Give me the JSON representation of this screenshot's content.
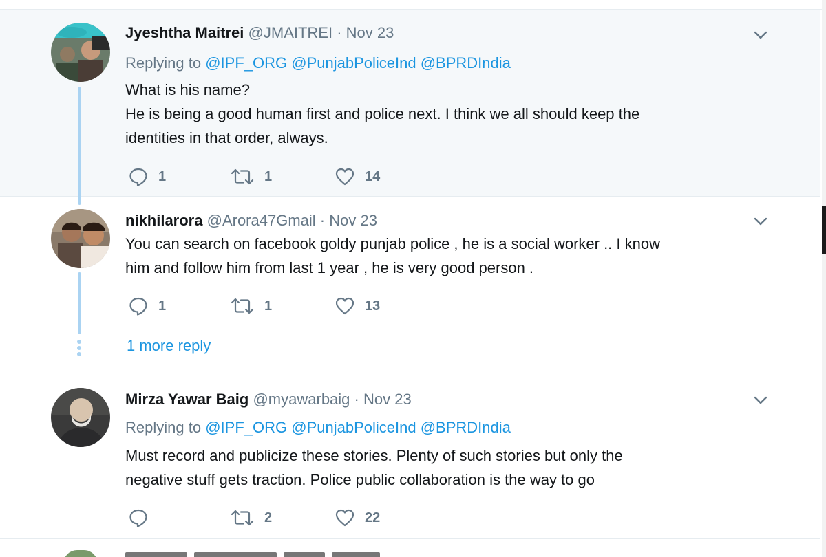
{
  "tweets": [
    {
      "name": "Jyeshtha Maitrei",
      "handle": "@JMAITREI",
      "dot": "·",
      "date": "Nov 23",
      "replying_label": "Replying to",
      "mentions": [
        "@IPF_ORG",
        "@PunjabPoliceInd",
        "@BPRDIndia"
      ],
      "lines": [
        "What is his name?",
        "He is being a good human first and police next. I think we all should keep the",
        "identities in that order, always."
      ],
      "replies": "1",
      "retweets": "1",
      "likes": "14"
    },
    {
      "name": "nikhilarora",
      "handle": "@Arora47Gmail",
      "dot": "·",
      "date": "Nov 23",
      "lines": [
        "You can search on facebook goldy punjab police , he is a social worker .. I know",
        "him and follow him from last 1 year , he is very good person ."
      ],
      "replies": "1",
      "retweets": "1",
      "likes": "13",
      "more_reply": "1 more reply"
    },
    {
      "name": "Mirza Yawar Baig",
      "handle": "@myawarbaig",
      "dot": "·",
      "date": "Nov 23",
      "replying_label": "Replying to",
      "mentions": [
        "@IPF_ORG",
        "@PunjabPoliceInd",
        "@BPRDIndia"
      ],
      "lines": [
        "Must record and publicize these stories. Plenty of such stories but only the",
        "negative stuff gets traction. Police public collaboration is the way to go"
      ],
      "replies": "",
      "retweets": "2",
      "likes": "22"
    }
  ],
  "icons": {
    "reply": "reply-icon",
    "retweet": "retweet-icon",
    "like": "heart-icon",
    "caret": "chevron-down-icon"
  },
  "colors": {
    "link": "#1b95e0",
    "muted": "#657786",
    "thread": "#aad3f2",
    "highlight_bg": "#f5f8fa"
  }
}
